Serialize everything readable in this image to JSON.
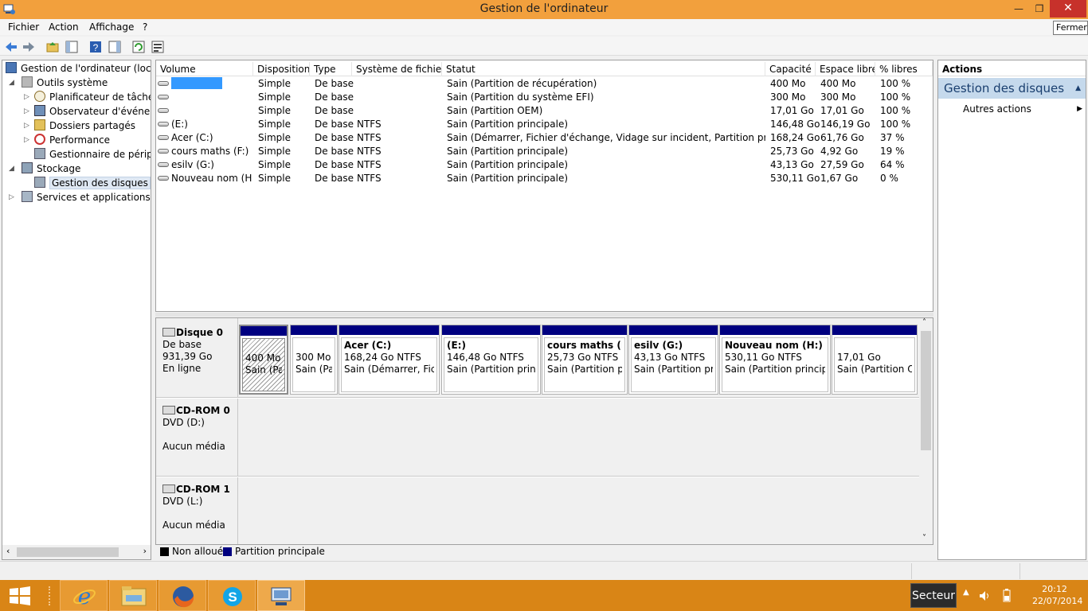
{
  "window": {
    "title": "Gestion de l'ordinateur",
    "close_tooltip": "Fermer",
    "minimize_glyph": "—",
    "maximize_glyph": "❐",
    "close_glyph": "✕"
  },
  "menu": [
    "Fichier",
    "Action",
    "Affichage",
    "?"
  ],
  "toolbar": {
    "icons": [
      "back-arrow-icon",
      "forward-arrow-icon",
      "up-folder-icon",
      "show-hide-tree-icon",
      "help-icon",
      "show-hide-action-pane-icon",
      "refresh-icon",
      "properties-icon"
    ]
  },
  "tree": {
    "items": [
      {
        "label": "Gestion de l'ordinateur (local)",
        "icon": "computer-management-icon"
      },
      {
        "label": "Outils système",
        "icon": "tools-icon"
      },
      {
        "label": "Planificateur de tâches",
        "icon": "clock-icon"
      },
      {
        "label": "Observateur d'événeme",
        "icon": "event-viewer-icon"
      },
      {
        "label": "Dossiers partagés",
        "icon": "shared-folder-icon"
      },
      {
        "label": "Performance",
        "icon": "performance-icon"
      },
      {
        "label": "Gestionnaire de périphé",
        "icon": "device-manager-icon"
      },
      {
        "label": "Stockage",
        "icon": "storage-icon"
      },
      {
        "label": "Gestion des disques",
        "icon": "disk-management-icon"
      },
      {
        "label": "Services et applications",
        "icon": "services-icon"
      }
    ],
    "scroll_left": "‹",
    "scroll_right": "›"
  },
  "volumes": {
    "columns": [
      "Volume",
      "Disposition",
      "Type",
      "Système de fichiers",
      "Statut",
      "Capacité",
      "Espace libre",
      "% libres"
    ],
    "rows": [
      {
        "volume": "",
        "layout": "Simple",
        "type": "De base",
        "fs": "",
        "status": "Sain (Partition de récupération)",
        "capacity": "400 Mo",
        "free": "400 Mo",
        "pct": "100 %"
      },
      {
        "volume": "",
        "layout": "Simple",
        "type": "De base",
        "fs": "",
        "status": "Sain (Partition du système EFI)",
        "capacity": "300 Mo",
        "free": "300 Mo",
        "pct": "100 %"
      },
      {
        "volume": "",
        "layout": "Simple",
        "type": "De base",
        "fs": "",
        "status": "Sain (Partition OEM)",
        "capacity": "17,01 Go",
        "free": "17,01 Go",
        "pct": "100 %"
      },
      {
        "volume": "(E:)",
        "layout": "Simple",
        "type": "De base",
        "fs": "NTFS",
        "status": "Sain (Partition principale)",
        "capacity": "146,48 Go",
        "free": "146,19 Go",
        "pct": "100 %"
      },
      {
        "volume": "Acer (C:)",
        "layout": "Simple",
        "type": "De base",
        "fs": "NTFS",
        "status": "Sain (Démarrer, Fichier d'échange, Vidage sur incident, Partition principale)",
        "capacity": "168,24 Go",
        "free": "61,76 Go",
        "pct": "37 %"
      },
      {
        "volume": "cours maths (F:)",
        "layout": "Simple",
        "type": "De base",
        "fs": "NTFS",
        "status": "Sain (Partition principale)",
        "capacity": "25,73 Go",
        "free": "4,92 Go",
        "pct": "19 %"
      },
      {
        "volume": "esilv (G:)",
        "layout": "Simple",
        "type": "De base",
        "fs": "NTFS",
        "status": "Sain (Partition principale)",
        "capacity": "43,13 Go",
        "free": "27,59 Go",
        "pct": "64 %"
      },
      {
        "volume": "Nouveau nom (H:)",
        "layout": "Simple",
        "type": "De base",
        "fs": "NTFS",
        "status": "Sain (Partition principale)",
        "capacity": "530,11 Go",
        "free": "1,67 Go",
        "pct": "0 %"
      }
    ]
  },
  "disks": [
    {
      "name": "Disque 0",
      "kind": "De base",
      "size": "931,39 Go",
      "state": "En ligne",
      "partitions": [
        {
          "name": "",
          "size": "400 Mo",
          "status": "Sain (Parti"
        },
        {
          "name": "",
          "size": "300 Mo",
          "status": "Sain (Par"
        },
        {
          "name": "Acer  (C:)",
          "size": "168,24 Go NTFS",
          "status": "Sain (Démarrer, Fichie"
        },
        {
          "name": "(E:)",
          "size": "146,48 Go NTFS",
          "status": "Sain (Partition princip"
        },
        {
          "name": "cours maths  (F:)",
          "size": "25,73 Go NTFS",
          "status": "Sain (Partition prir"
        },
        {
          "name": "esilv  (G:)",
          "size": "43,13 Go NTFS",
          "status": "Sain (Partition prin"
        },
        {
          "name": "Nouveau nom  (H:)",
          "size": "530,11 Go NTFS",
          "status": "Sain (Partition principale"
        },
        {
          "name": "",
          "size": "17,01 Go",
          "status": "Sain (Partition OE"
        }
      ]
    },
    {
      "name": "CD-ROM 0",
      "kind": "DVD (D:)",
      "state": "Aucun média"
    },
    {
      "name": "CD-ROM 1",
      "kind": "DVD (L:)",
      "state": "Aucun média"
    }
  ],
  "disk_scroll": {
    "up": "˄",
    "down": "˅"
  },
  "legend": [
    {
      "label": "Non alloué",
      "color": "#000000"
    },
    {
      "label": "Partition principale",
      "color": "#000080"
    }
  ],
  "actions": {
    "header": "Actions",
    "section": "Gestion des disques",
    "section_caret": "▲",
    "item": "Autres actions",
    "item_caret": "▶"
  },
  "taskbar": {
    "apps": [
      "start-icon",
      "internet-explorer-icon",
      "file-explorer-icon",
      "firefox-icon",
      "skype-icon",
      "computer-management-icon"
    ],
    "power": "Secteur",
    "tray_arrow": "▲",
    "time": "20:12",
    "date": "22/07/2014"
  },
  "colors": {
    "titlebar": "#f2a03d",
    "taskbar": "#d98516",
    "primary_partition": "#000080",
    "selected_volume": "#3399ff",
    "action_section": "#c5d9ec"
  }
}
